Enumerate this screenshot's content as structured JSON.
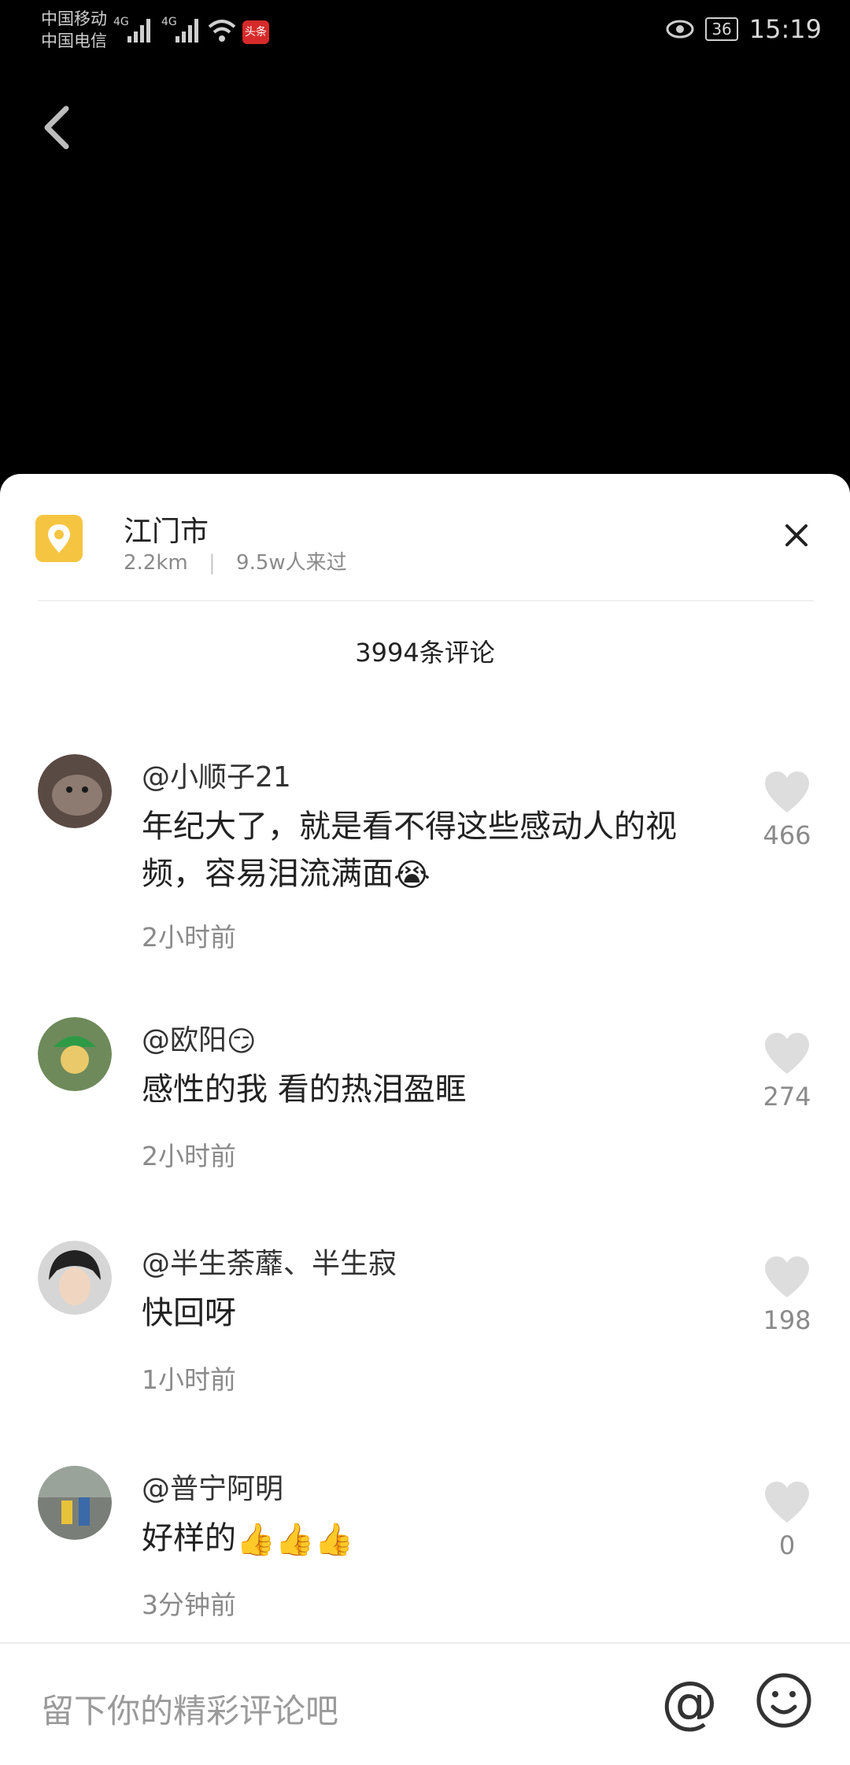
{
  "status_bar": {
    "carrier1": "中国移动",
    "carrier2": "中国电信",
    "sig1": "4G",
    "sig2": "4G",
    "toutiao": "头条",
    "battery": "36",
    "time": "15:19"
  },
  "location": {
    "title": "江门市",
    "distance": "2.2km",
    "separator": "|",
    "visitors": "9.5w人来过"
  },
  "comments_count": "3994条评论",
  "comments": [
    {
      "author": "@小顺子21",
      "text": "年纪大了，就是看不得这些感动人的视频，容易泪流满面",
      "text_emoji": "😭",
      "time": "2小时前",
      "likes": "466"
    },
    {
      "author": "@欧阳",
      "author_emoji": "😏",
      "text": "感性的我 看的热泪盈眶",
      "time": "2小时前",
      "likes": "274"
    },
    {
      "author": "@半生荼蘼、半生寂",
      "text": "快回呀",
      "time": "1小时前",
      "likes": "198"
    },
    {
      "author": "@普宁阿明",
      "text": "好样的",
      "time": "3分钟前",
      "likes": "0"
    }
  ],
  "input": {
    "placeholder": "留下你的精彩评论吧",
    "at_label": "@"
  },
  "colors": {
    "accent_location": "#f5c542",
    "heart_gray": "#dddddd",
    "sheet_bg": "#ffffff"
  }
}
